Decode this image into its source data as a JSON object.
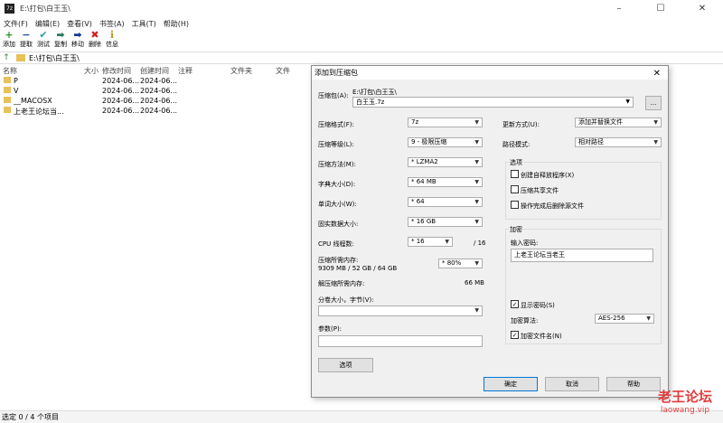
{
  "window": {
    "title": "E:\\打包\\白王玉\\",
    "controls": [
      "–",
      "☐",
      "✕"
    ]
  },
  "menu": [
    "文件(F)",
    "编辑(E)",
    "查看(V)",
    "书签(A)",
    "工具(T)",
    "帮助(H)"
  ],
  "toolbar": [
    {
      "label": "添加",
      "icon": "+",
      "color": "#2a9a2a"
    },
    {
      "label": "提取",
      "icon": "−",
      "color": "#1a4fb0"
    },
    {
      "label": "测试",
      "icon": "✔",
      "color": "#2aa0a0"
    },
    {
      "label": "复制",
      "icon": "➡",
      "color": "#2a7a5a"
    },
    {
      "label": "移动",
      "icon": "➡",
      "color": "#1a3a90"
    },
    {
      "label": "删除",
      "icon": "✖",
      "color": "#cc2222"
    },
    {
      "label": "信息",
      "icon": "ℹ",
      "color": "#b09a20"
    }
  ],
  "address": {
    "path": "E:\\打包\\白王玉\\"
  },
  "filelist": {
    "columns": [
      "名称",
      "大小",
      "修改时间",
      "创建时间",
      "注释",
      "文件夹",
      "文件"
    ],
    "rows": [
      {
        "name": "P",
        "modified": "2024-06...",
        "created": "2024-06..."
      },
      {
        "name": "V",
        "modified": "2024-06...",
        "created": "2024-06..."
      },
      {
        "name": "__MACOSX",
        "modified": "2024-06...",
        "created": "2024-06..."
      },
      {
        "name": "上老王论坛当...",
        "modified": "2024-06...",
        "created": "2024-06..."
      }
    ]
  },
  "status": "选定 0 / 4 个项目",
  "dialog": {
    "title": "添加到压缩包",
    "close": "✕",
    "archive_label": "压缩包(A):",
    "archive_path": "E:\\打包\\白王玉\\",
    "archive_name": "白王玉.7z",
    "browse": "...",
    "format_label": "压缩格式(F):",
    "format_value": "7z",
    "level_label": "压缩等级(L):",
    "level_value": "9 - 极限压缩",
    "method_label": "压缩方法(M):",
    "method_value": "* LZMA2",
    "dict_label": "字典大小(D):",
    "dict_value": "* 64 MB",
    "word_label": "单词大小(W):",
    "word_value": "* 64",
    "solid_label": "固实数据大小:",
    "solid_value": "* 16 GB",
    "cpu_label": "CPU 线程数:",
    "cpu_value": "* 16",
    "cpu_total": "/ 16",
    "mem_label": "压缩所需内存:",
    "mem_detail": "9309 MB / 52 GB / 64 GB",
    "mem_value": "* 80%",
    "decomp_label": "解压缩所需内存:",
    "decomp_value": "66 MB",
    "split_label": "分卷大小，字节(V):",
    "split_value": "",
    "params_label": "参数(P):",
    "params_value": "",
    "options_button": "选项",
    "update_label": "更新方式(U):",
    "update_value": "添加并替换文件",
    "path_label": "路径模式:",
    "path_value": "相对路径",
    "options_group": "选项",
    "opt_sfx": "创建自释放程序(X)",
    "opt_shared": "压缩共享文件",
    "opt_delete": "操作完成后删除源文件",
    "encrypt_group": "加密",
    "password_label": "输入密码:",
    "password_value": "上老王论坛当老王",
    "show_password": "显示密码(S)",
    "enc_method_label": "加密算法:",
    "enc_method_value": "AES-256",
    "encrypt_names": "加密文件名(N)",
    "ok": "确定",
    "cancel": "取消",
    "help": "帮助"
  },
  "watermark": {
    "line1": "老王论坛",
    "line2": "laowang.vip"
  }
}
